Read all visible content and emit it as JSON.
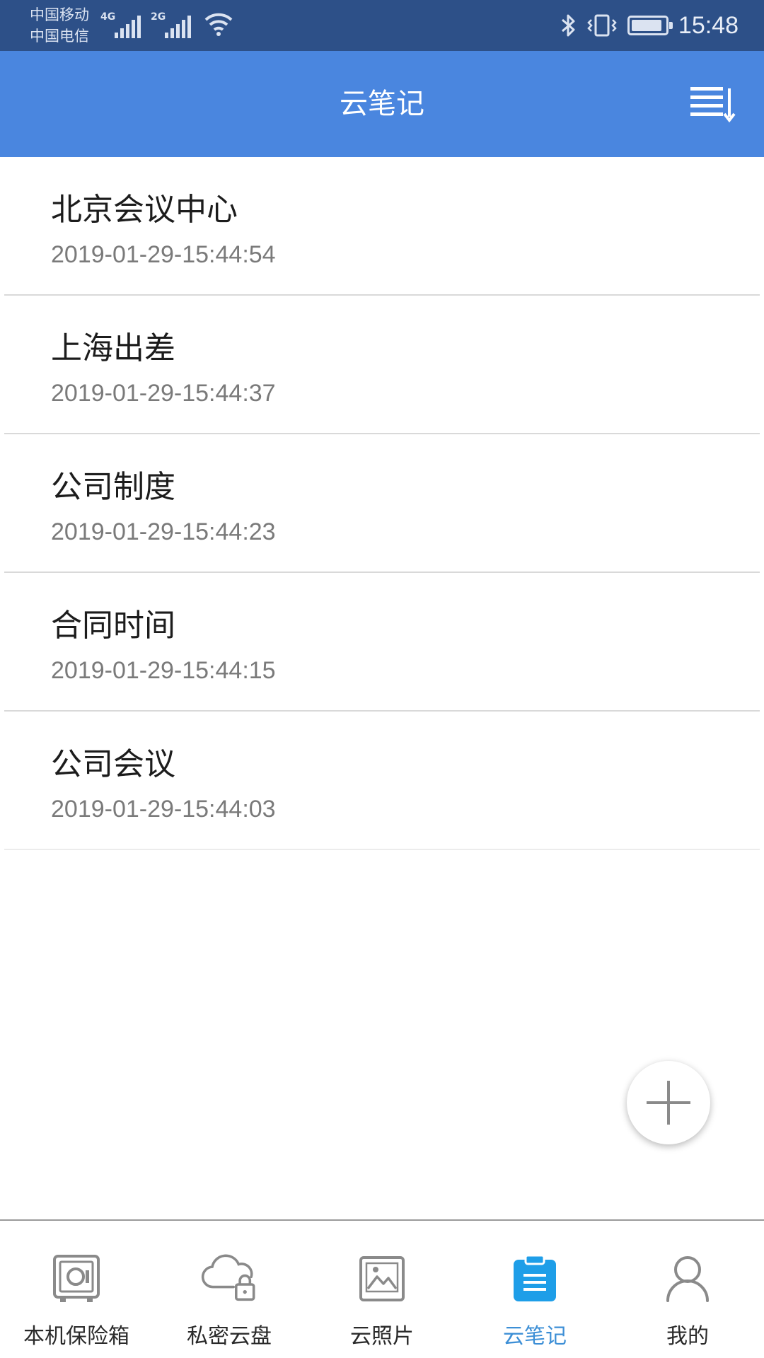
{
  "status_bar": {
    "carrier_1": "中国移动",
    "carrier_2": "中国电信",
    "network_1": "4G",
    "network_2": "2G",
    "time": "15:48",
    "icons": [
      "signal-icon",
      "wifi-icon",
      "bluetooth-icon",
      "vibrate-icon",
      "battery-icon"
    ]
  },
  "header": {
    "title": "云笔记",
    "background": "#4a86df",
    "sort_icon": "sort-list-icon"
  },
  "notes": [
    {
      "title": "北京会议中心",
      "time": "2019-01-29-15:44:54"
    },
    {
      "title": "上海出差",
      "time": "2019-01-29-15:44:37"
    },
    {
      "title": "公司制度",
      "time": "2019-01-29-15:44:23"
    },
    {
      "title": "合同时间",
      "time": "2019-01-29-15:44:15"
    },
    {
      "title": "公司会议",
      "time": "2019-01-29-15:44:03"
    }
  ],
  "fab": {
    "icon": "plus-icon"
  },
  "bottom_nav": {
    "active_color": "#3d8fd6",
    "items": [
      {
        "label": "本机保险箱",
        "icon": "safe-icon"
      },
      {
        "label": "私密云盘",
        "icon": "cloud-lock-icon"
      },
      {
        "label": "云照片",
        "icon": "photo-icon"
      },
      {
        "label": "云笔记",
        "icon": "notes-icon",
        "active": true
      },
      {
        "label": "我的",
        "icon": "user-icon"
      }
    ]
  }
}
